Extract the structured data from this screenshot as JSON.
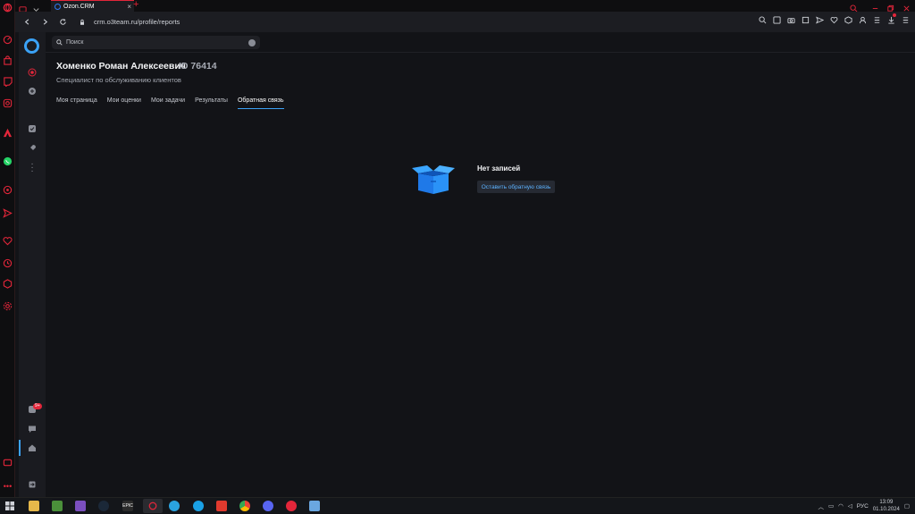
{
  "browser": {
    "tab_title": "Ozon.CRM",
    "tab_close": "×",
    "new_tab": "+",
    "url": "crm.o3team.ru/profile/reports"
  },
  "search": {
    "placeholder": "Поиск"
  },
  "profile": {
    "name": "Хоменко Роман Алексеевич",
    "id": "ID 76414",
    "role": "Специалист по обслуживанию клиентов"
  },
  "tabs": [
    {
      "label": "Моя страница",
      "active": false
    },
    {
      "label": "Мои оценки",
      "active": false
    },
    {
      "label": "Мои задачи",
      "active": false
    },
    {
      "label": "Результаты",
      "active": false
    },
    {
      "label": "Обратная связь",
      "active": true
    }
  ],
  "empty_state": {
    "title": "Нет записей",
    "button": "Оставить обратную связь"
  },
  "rail": {
    "notification_badge": "9+"
  },
  "taskbar": {
    "lang": "РУС",
    "time": "13:09",
    "date": "01.10.2024"
  },
  "colors": {
    "accent": "#3ba2f6",
    "opera_red": "#e3263a",
    "background": "#121317"
  }
}
